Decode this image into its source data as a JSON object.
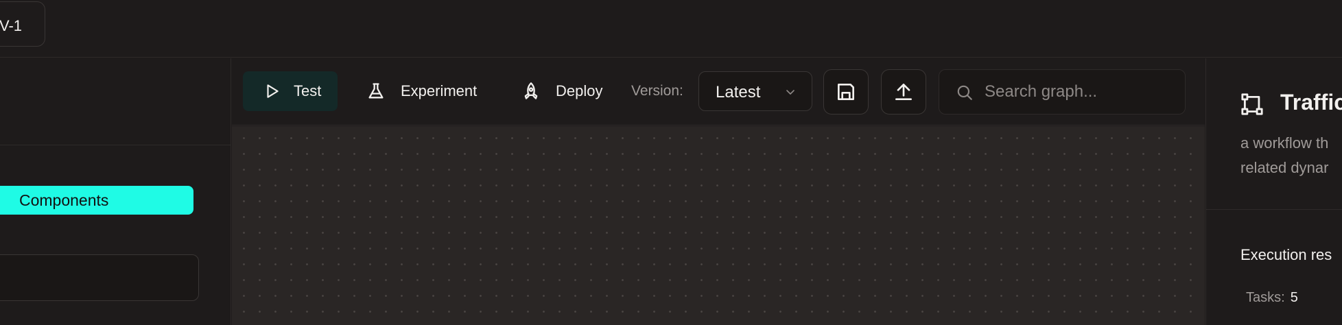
{
  "header": {
    "tab_label": "V-1"
  },
  "left_panel": {
    "components_label": "Components"
  },
  "toolbar": {
    "test_label": "Test",
    "experiment_label": "Experiment",
    "deploy_label": "Deploy",
    "version_label": "Version:",
    "version_value": "Latest",
    "save_icon": "save-icon",
    "upload_icon": "upload-icon"
  },
  "search": {
    "placeholder": "Search graph..."
  },
  "right_panel": {
    "title": "Traffic",
    "description_line1": "a workflow th",
    "description_line2": "related dynar",
    "execution_title": "Execution res",
    "tasks_label": "Tasks:",
    "tasks_value": "5"
  },
  "colors": {
    "accent": "#1ffbe5",
    "background": "#1e1b1b",
    "canvas": "#2a2625",
    "test_bg": "#142928"
  }
}
